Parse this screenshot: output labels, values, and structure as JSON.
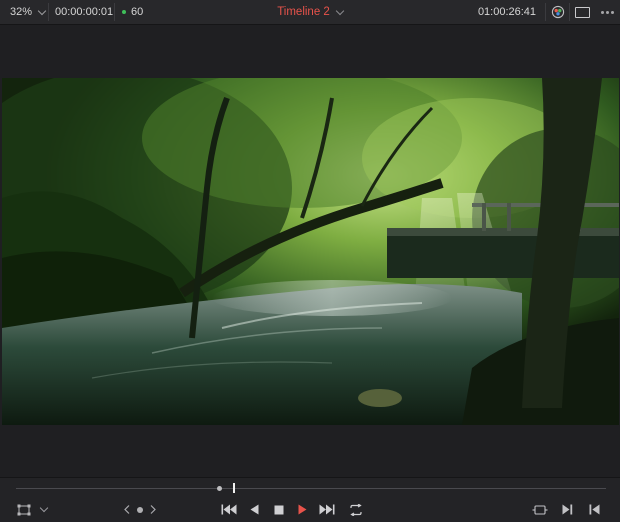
{
  "toolbar": {
    "zoom": "32%",
    "source_timecode": "00:00:00:01",
    "fps": "60",
    "timeline_title": "Timeline 2",
    "record_timecode": "01:00:26:41"
  },
  "colors": {
    "timeline_title": "#e8534b",
    "play_button": "#e8534b",
    "fps_indicator": "#3fbf5a",
    "toolbar_bg": "#28282b",
    "viewer_bg": "#1f1f22"
  },
  "icons": {
    "toolbar": [
      "zoom-dropdown-chevron-icon",
      "fps-status-dot-icon",
      "timeline-dropdown-chevron-icon",
      "color-wheels-icon",
      "viewer-mode-icon",
      "more-options-icon"
    ],
    "transport": [
      "transform-overlay-icon",
      "overlay-dropdown-chevron-icon",
      "previous-marker-icon",
      "jog-dot-icon",
      "next-marker-icon",
      "go-to-start-icon",
      "play-reverse-icon",
      "stop-icon",
      "play-icon",
      "go-to-end-icon",
      "loop-icon",
      "match-frame-icon",
      "next-frame-icon",
      "previous-edit-icon"
    ]
  },
  "scrubber": {
    "playhead_progress": 0.37,
    "in_point_progress": 0.345
  }
}
